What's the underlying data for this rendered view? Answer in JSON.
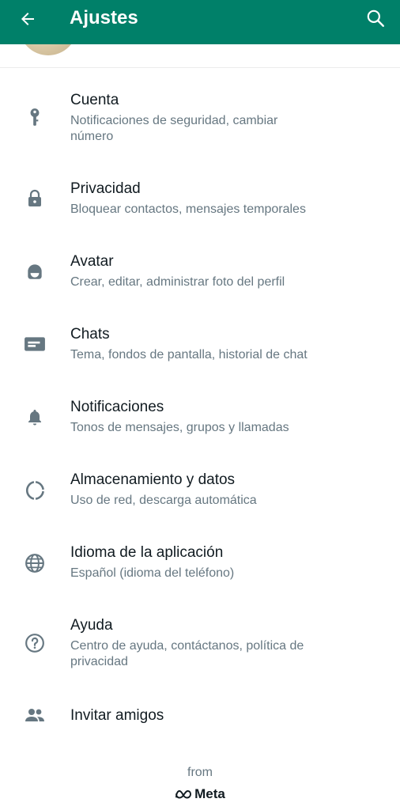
{
  "colors": {
    "app_bar": "#008069",
    "icon": "#667781",
    "title_text": "#111b21",
    "subtitle_text": "#667781"
  },
  "header": {
    "title": "Ajustes",
    "back_icon": "arrow-left-icon",
    "search_icon": "search-icon"
  },
  "settings": {
    "items": [
      {
        "icon": "key-icon",
        "title": "Cuenta",
        "subtitle_lines": [
          "Notificaciones de seguridad, cambiar",
          "número"
        ]
      },
      {
        "icon": "lock-icon",
        "title": "Privacidad",
        "subtitle_lines": [
          "Bloquear contactos, mensajes temporales"
        ]
      },
      {
        "icon": "avatar-face-icon",
        "title": "Avatar",
        "subtitle_lines": [
          "Crear, editar, administrar foto del perfil"
        ]
      },
      {
        "icon": "chat-icon",
        "title": "Chats",
        "subtitle_lines": [
          "Tema, fondos de pantalla, historial de chat"
        ]
      },
      {
        "icon": "bell-icon",
        "title": "Notificaciones",
        "subtitle_lines": [
          "Tonos de mensajes, grupos y llamadas"
        ]
      },
      {
        "icon": "storage-ring-icon",
        "title": "Almacenamiento y datos",
        "subtitle_lines": [
          "Uso de red, descarga automática"
        ]
      },
      {
        "icon": "globe-icon",
        "title": "Idioma de la aplicación",
        "subtitle_lines": [
          "Español (idioma del teléfono)"
        ]
      },
      {
        "icon": "help-icon",
        "title": "Ayuda",
        "subtitle_lines": [
          "Centro de ayuda, contáctanos, política de",
          "privacidad"
        ]
      },
      {
        "icon": "people-icon",
        "title": "Invitar amigos",
        "subtitle_lines": []
      }
    ]
  },
  "footer": {
    "from_label": "from",
    "brand": "Meta",
    "brand_icon": "meta-logo-icon"
  }
}
